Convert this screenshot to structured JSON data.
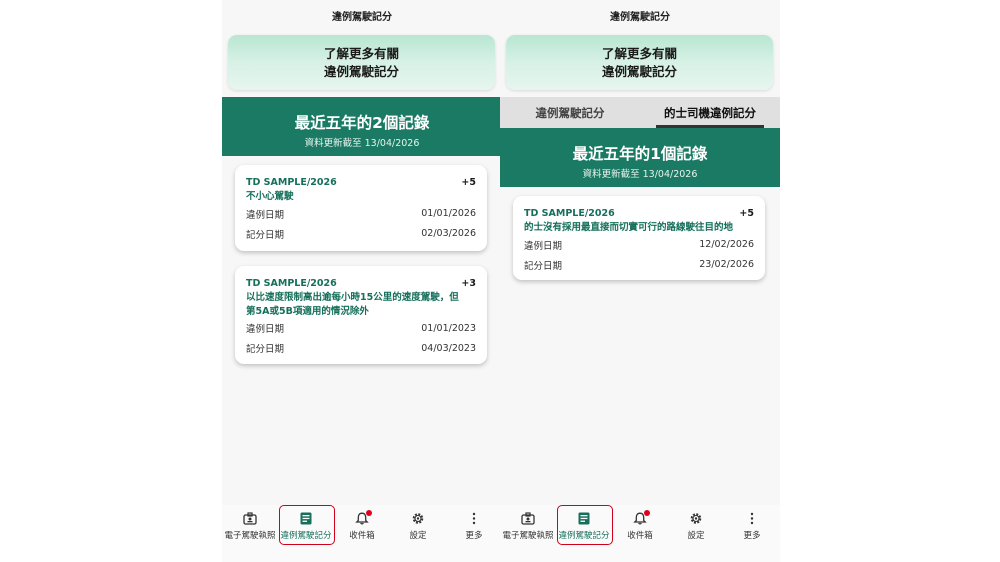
{
  "colors": {
    "accent": "#1a7a64",
    "accent_text": "#156f5b",
    "highlight": "#d0021b",
    "badge": "#e0001b"
  },
  "left": {
    "title": "違例駕駛記分",
    "learn_more": {
      "line1": "了解更多有關",
      "line2": "違例駕駛記分"
    },
    "summary": {
      "headline": "最近五年的2個記錄",
      "updated": "資料更新截至 13/04/2026"
    },
    "records": [
      {
        "code": "TD SAMPLE/2026",
        "points": "+5",
        "desc": "不小心駕駛",
        "rows": [
          {
            "label": "違例日期",
            "value": "01/01/2026"
          },
          {
            "label": "記分日期",
            "value": "02/03/2026"
          }
        ]
      },
      {
        "code": "TD SAMPLE/2026",
        "points": "+3",
        "desc": "以比速度限制高出逾每小時15公里的速度駕駛，但第5A或5B項適用的情況除外",
        "rows": [
          {
            "label": "違例日期",
            "value": "01/01/2023"
          },
          {
            "label": "記分日期",
            "value": "04/03/2023"
          }
        ]
      }
    ]
  },
  "right": {
    "title": "違例駕駛記分",
    "learn_more": {
      "line1": "了解更多有關",
      "line2": "違例駕駛記分"
    },
    "tabs": [
      {
        "label": "違例駕駛記分",
        "active": false
      },
      {
        "label": "的士司機違例記分",
        "active": true
      }
    ],
    "summary": {
      "headline": "最近五年的1個記錄",
      "updated": "資料更新截至 13/04/2026"
    },
    "records": [
      {
        "code": "TD SAMPLE/2026",
        "points": "+5",
        "desc": "的士沒有採用最直接而切實可行的路線駛往目的地",
        "rows": [
          {
            "label": "違例日期",
            "value": "12/02/2026"
          },
          {
            "label": "記分日期",
            "value": "23/02/2026"
          }
        ]
      }
    ]
  },
  "nav": [
    {
      "label": "電子駕駛執照",
      "icon": "license-icon"
    },
    {
      "label": "違例駕駛記分",
      "icon": "document-icon",
      "active": true
    },
    {
      "label": "收件箱",
      "icon": "bell-icon",
      "badge": true
    },
    {
      "label": "設定",
      "icon": "gear-icon"
    },
    {
      "label": "更多",
      "icon": "more-icon"
    }
  ]
}
